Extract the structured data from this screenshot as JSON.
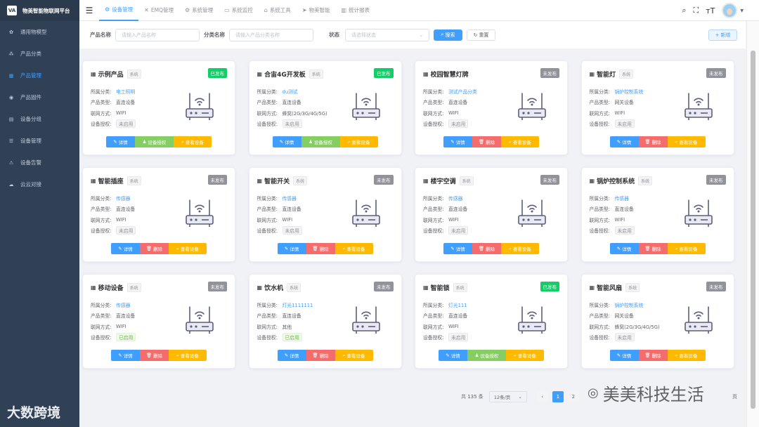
{
  "app": {
    "logo": "VA",
    "title": "物美智能物联网平台"
  },
  "sidebar": {
    "items": [
      {
        "icon": "gear-icon",
        "glyph": "✿",
        "label": "通用物模型",
        "active": false
      },
      {
        "icon": "hierarchy-icon",
        "glyph": "⁂",
        "label": "产品分类",
        "active": false
      },
      {
        "icon": "grid-icon",
        "glyph": "▦",
        "label": "产品管理",
        "active": true
      },
      {
        "icon": "chip-icon",
        "glyph": "◉",
        "label": "产品固件",
        "active": false
      },
      {
        "icon": "table-icon",
        "glyph": "▤",
        "label": "设备分组",
        "active": false
      },
      {
        "icon": "list-icon",
        "glyph": "☰",
        "label": "设备管理",
        "active": false
      },
      {
        "icon": "alarm-icon",
        "glyph": "⚠",
        "label": "设备告警",
        "active": false
      },
      {
        "icon": "cloud-icon",
        "glyph": "☁",
        "label": "云云对接",
        "active": false
      }
    ]
  },
  "watermark_left": "大数跨境",
  "tabs": [
    {
      "icon": "gear-icon",
      "glyph": "⚙",
      "label": "设备管理",
      "active": true
    },
    {
      "icon": "close-icon",
      "glyph": "✕",
      "label": "EMQ管理",
      "active": false
    },
    {
      "icon": "gear-icon",
      "glyph": "⚙",
      "label": "系统管理",
      "active": false
    },
    {
      "icon": "monitor-icon",
      "glyph": "▭",
      "label": "系统监控",
      "active": false
    },
    {
      "icon": "toolbox-icon",
      "glyph": "⌂",
      "label": "系统工具",
      "active": false
    },
    {
      "icon": "send-icon",
      "glyph": "➤",
      "label": "物美智能",
      "active": false
    },
    {
      "icon": "chart-icon",
      "glyph": "▥",
      "label": "统计报表",
      "active": false
    }
  ],
  "search": {
    "product_name_label": "产品名称",
    "product_name_placeholder": "请输入产品名称",
    "category_label": "分类名称",
    "category_placeholder": "请输入产品分类名称",
    "status_label": "状态",
    "status_placeholder": "请选择状态",
    "search_btn": "搜索",
    "reset_btn": "重置",
    "add_btn": "新增"
  },
  "card_labels": {
    "category": "所属分类:",
    "type": "产品类型:",
    "network": "联网方式:",
    "auth": "设备授权:"
  },
  "buttons": {
    "edit": "详情",
    "auth": "设备授权",
    "delete": "删除",
    "view": "查看设备"
  },
  "products": [
    {
      "name": "示例产品",
      "tag": "系统",
      "status": "已发布",
      "published": true,
      "category": "电工照明",
      "type": "直连设备",
      "network": "WIFI",
      "auth": "未启用",
      "auth_on": false
    },
    {
      "name": "合宙4G开发板",
      "tag": "系统",
      "status": "已发布",
      "published": true,
      "category": "du测试",
      "type": "直连设备",
      "network": "蜂窝(2G/3G/4G/5G)",
      "auth": "未启用",
      "auth_on": false
    },
    {
      "name": "校园智慧灯牌",
      "tag": "",
      "status": "未发布",
      "published": false,
      "category": "测试产品分类",
      "type": "直连设备",
      "network": "WIFI",
      "auth": "未启用",
      "auth_on": false
    },
    {
      "name": "智能灯",
      "tag": "系统",
      "status": "未发布",
      "published": false,
      "category": "锅炉控制系统",
      "type": "网关设备",
      "network": "WIFI",
      "auth": "未启用",
      "auth_on": false
    },
    {
      "name": "智能插座",
      "tag": "系统",
      "status": "未发布",
      "published": false,
      "category": "传感器",
      "type": "直连设备",
      "network": "WIFI",
      "auth": "未启用",
      "auth_on": false
    },
    {
      "name": "智能开关",
      "tag": "系统",
      "status": "未发布",
      "published": false,
      "category": "传感器",
      "type": "直连设备",
      "network": "WIFI",
      "auth": "未启用",
      "auth_on": false
    },
    {
      "name": "楼宇空调",
      "tag": "系统",
      "status": "未发布",
      "published": false,
      "category": "传感器",
      "type": "直连设备",
      "network": "WIFI",
      "auth": "未启用",
      "auth_on": false
    },
    {
      "name": "锅炉控制系统",
      "tag": "系统",
      "status": "未发布",
      "published": false,
      "category": "传感器",
      "type": "直连设备",
      "network": "WIFI",
      "auth": "未启用",
      "auth_on": false
    },
    {
      "name": "移动设备",
      "tag": "系统",
      "status": "未发布",
      "published": false,
      "category": "传感器",
      "type": "直连设备",
      "network": "WIFI",
      "auth": "已启用",
      "auth_on": true
    },
    {
      "name": "饮水机",
      "tag": "系统",
      "status": "未发布",
      "published": false,
      "category": "灯光1111111",
      "type": "直连设备",
      "network": "其他",
      "auth": "已启用",
      "auth_on": true
    },
    {
      "name": "智能锁",
      "tag": "系统",
      "status": "已发布",
      "published": true,
      "category": "灯光111",
      "type": "直连设备",
      "network": "WIFI",
      "auth": "未启用",
      "auth_on": false
    },
    {
      "name": "智能风扇",
      "tag": "系统",
      "status": "未发布",
      "published": false,
      "category": "锅炉控制系统",
      "type": "网关设备",
      "network": "蜂窝(2G/3G/4G/5G)",
      "auth": "未启用",
      "auth_on": false
    }
  ],
  "pagination": {
    "total": "共 135 条",
    "page_size": "12条/页",
    "pages": [
      "1",
      "2"
    ],
    "current": "1",
    "tail": "页"
  },
  "watermark_right": "美美科技生活",
  "colors": {
    "primary": "#409eff",
    "sidebar_bg": "#304156",
    "published": "#13ce66",
    "unpublished": "#909399",
    "delete": "#f56c6c",
    "view": "#ffba00",
    "auth": "#85ce61"
  }
}
